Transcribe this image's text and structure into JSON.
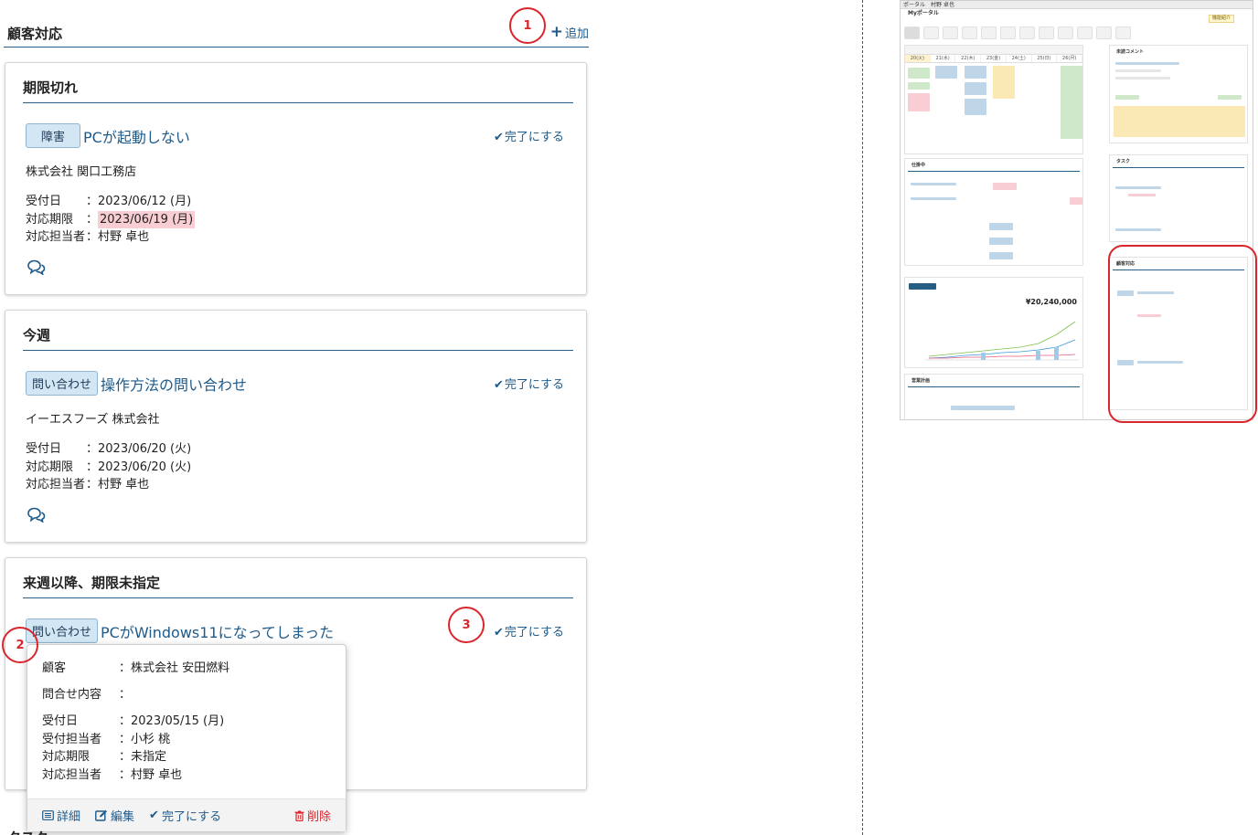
{
  "section": {
    "title": "顧客対応",
    "add_label": "追加"
  },
  "markers": [
    "1",
    "2",
    "3"
  ],
  "groups": [
    {
      "title": "期限切れ",
      "item": {
        "category": "障害",
        "title": "PCが起動しない",
        "complete_label": "完了にする",
        "company": "株式会社 関口工務店",
        "received_label": "受付日",
        "received_value": "：2023/06/12 (月)",
        "deadline_label": "対応期限",
        "deadline_value": "2023/06/19 (月)",
        "assignee_label": "対応担当者",
        "assignee_value": "：村野 卓也"
      }
    },
    {
      "title": "今週",
      "item": {
        "category": "問い合わせ",
        "title": "操作方法の問い合わせ",
        "complete_label": "完了にする",
        "company": "イーエスフーズ 株式会社",
        "received_label": "受付日",
        "received_value": "：2023/06/20 (火)",
        "deadline_label": "対応期限",
        "deadline_value": "：2023/06/20 (火)",
        "assignee_label": "対応担当者",
        "assignee_value": "：村野 卓也"
      }
    },
    {
      "title": "来週以降、期限未指定",
      "item": {
        "category": "問い合わせ",
        "title": "PCがWindows11になってしまった",
        "complete_label": "完了にする"
      }
    }
  ],
  "popup": {
    "customer_label": "顧客",
    "customer_value": "：株式会社 安田燃料",
    "inquiry_label": "問合せ内容",
    "inquiry_value": "：",
    "received_label": "受付日",
    "received_value": "：2023/05/15 (月)",
    "receiver_label": "受付担当者",
    "receiver_value": "：小杉 桃",
    "deadline_label": "対応期限",
    "deadline_value": "：未指定",
    "assignee_label": "対応担当者",
    "assignee_value": "：村野 卓也",
    "actions": {
      "detail": "詳細",
      "edit": "編集",
      "complete": "完了にする",
      "delete": "削除"
    }
  },
  "bottom_cut_label": "タスク",
  "thumbnail": {
    "top_bar": "ポータル",
    "user": "村野 卓也",
    "tab": "Myポータル",
    "help": "機能紹介",
    "amount": "¥20,240,000",
    "days": [
      "20(火)",
      "21(水)",
      "22(木)",
      "23(金)",
      "24(土)",
      "25(日)",
      "26(月)"
    ],
    "panels": {
      "comments": "未読コメント",
      "tasks": "タスク",
      "customer": "顧客対応",
      "orders": "仕掛中",
      "plan": "営業計画"
    },
    "colors": {
      "accent": "#1e5a8a",
      "highlight": "#d9262c",
      "overdue": "#f8cdd3"
    }
  }
}
